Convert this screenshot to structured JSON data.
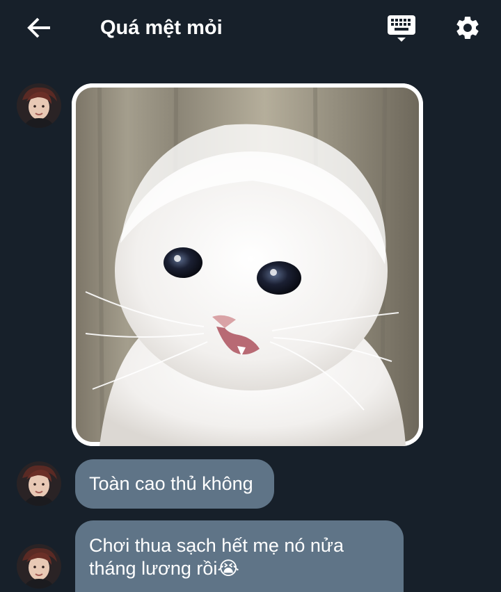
{
  "header": {
    "title": "Quá mệt mỏi",
    "back_icon": "arrow-left-icon",
    "keyboard_icon": "keyboard-icon",
    "settings_icon": "gear-icon"
  },
  "messages": [
    {
      "type": "image",
      "description_icon": "crying-cat-photo"
    },
    {
      "type": "text",
      "text": "Toàn cao thủ không"
    },
    {
      "type": "text",
      "text": "Chơi thua sạch hết mẹ nó nửa tháng lương rồi😭"
    }
  ],
  "colors": {
    "background": "#17202a",
    "bubble": "#5f7487",
    "icon": "#ffffff"
  }
}
